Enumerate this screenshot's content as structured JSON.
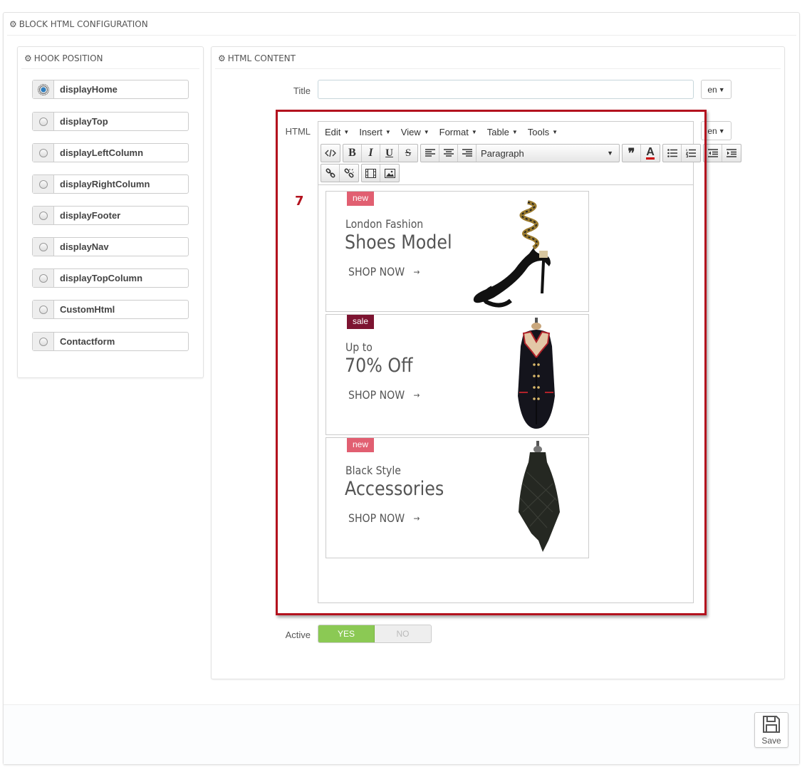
{
  "main_panel": {
    "heading": "BLOCK HTML CONFIGURATION",
    "icon": "gear-icon"
  },
  "hook_panel": {
    "heading": "HOOK POSITION",
    "icon": "gear-icon",
    "hooks": [
      {
        "label": "displayHome",
        "checked": true
      },
      {
        "label": "displayTop",
        "checked": false
      },
      {
        "label": "displayLeftColumn",
        "checked": false
      },
      {
        "label": "displayRightColumn",
        "checked": false
      },
      {
        "label": "displayFooter",
        "checked": false
      },
      {
        "label": "displayNav",
        "checked": false
      },
      {
        "label": "displayTopColumn",
        "checked": false
      },
      {
        "label": "CustomHtml",
        "checked": false
      },
      {
        "label": "Contactform",
        "checked": false
      }
    ]
  },
  "html_panel": {
    "heading": "HTML CONTENT",
    "icon": "gear-icon",
    "title_label": "Title",
    "title_value": "",
    "html_label": "HTML",
    "lang": "en",
    "step_number": "7",
    "editor": {
      "menus": [
        "Edit",
        "Insert",
        "View",
        "Format",
        "Table",
        "Tools"
      ],
      "format_select": "Paragraph"
    },
    "banners": [
      {
        "badge": "new",
        "subtitle": "London Fashion",
        "headline": "Shoes Model",
        "cta": "SHOP NOW",
        "arrow": "→"
      },
      {
        "badge": "sale",
        "subtitle": "Up to",
        "headline": "70% Off",
        "cta": "SHOP NOW",
        "arrow": "→"
      },
      {
        "badge": "new",
        "subtitle": "Black Style",
        "headline": "Accessories",
        "cta": "SHOP NOW",
        "arrow": "→"
      }
    ],
    "active_label": "Active",
    "active_yes": "YES",
    "active_no": "NO",
    "active_value": true
  },
  "footer": {
    "save_label": "Save",
    "save_icon": "floppy-disk-icon"
  },
  "colors": {
    "highlight": "#b3121e",
    "badge_new": "#e15f71",
    "badge_sale": "#7d1431",
    "switch_on": "#8bc954"
  }
}
